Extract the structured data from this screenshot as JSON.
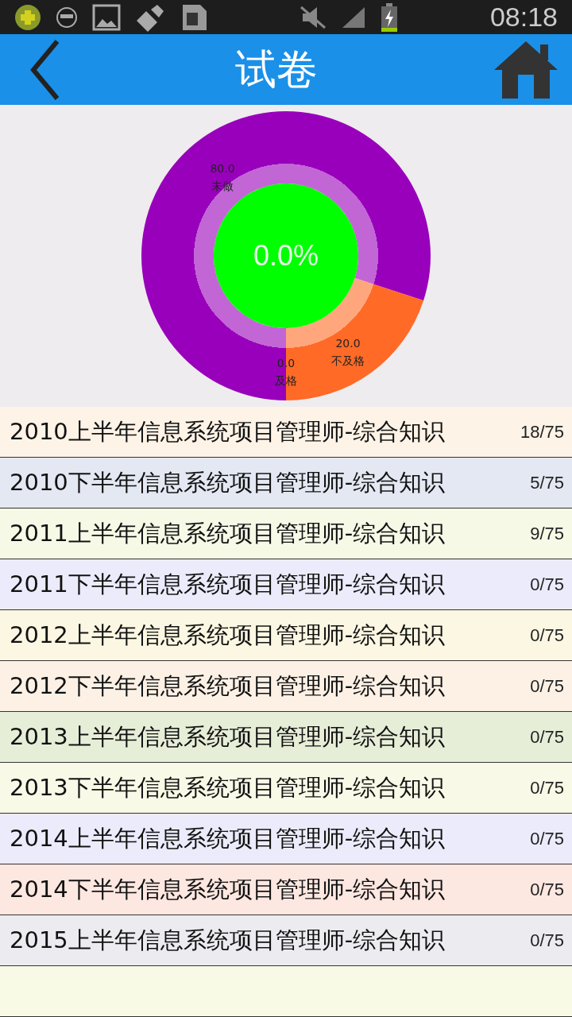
{
  "status_bar": {
    "time": "08:18"
  },
  "header": {
    "title": "试卷"
  },
  "chart": {
    "center_label": "0.0%",
    "chart_data": {
      "type": "donut",
      "categories": [
        "未做",
        "不及格",
        "及格"
      ],
      "values": [
        80.0,
        20.0,
        0.0
      ],
      "value_labels": [
        "80.0",
        "20.0",
        "0.0"
      ]
    },
    "segments": [
      {
        "color": "#9900bb"
      },
      {
        "color": "#ff6a26"
      }
    ]
  },
  "papers": [
    {
      "title": "2010上半年信息系统项目管理师-综合知识",
      "progress": "18/75",
      "color": "#fdf3e6"
    },
    {
      "title": "2010下半年信息系统项目管理师-综合知识",
      "progress": "5/75",
      "color": "#e3e8f2"
    },
    {
      "title": "2011上半年信息系统项目管理师-综合知识",
      "progress": "9/75",
      "color": "#f5f9e6"
    },
    {
      "title": "2011下半年信息系统项目管理师-综合知识",
      "progress": "0/75",
      "color": "#ecebfb"
    },
    {
      "title": "2012上半年信息系统项目管理师-综合知识",
      "progress": "0/75",
      "color": "#fbf7e2"
    },
    {
      "title": "2012下半年信息系统项目管理师-综合知识",
      "progress": "0/75",
      "color": "#fdf1e6"
    },
    {
      "title": "2013上半年信息系统项目管理师-综合知识",
      "progress": "0/75",
      "color": "#e7eed8"
    },
    {
      "title": "2013下半年信息系统项目管理师-综合知识",
      "progress": "0/75",
      "color": "#f8f9e6"
    },
    {
      "title": "2014上半年信息系统项目管理师-综合知识",
      "progress": "0/75",
      "color": "#ecebfb"
    },
    {
      "title": "2014下半年信息系统项目管理师-综合知识",
      "progress": "0/75",
      "color": "#fde7e1"
    },
    {
      "title": "2015上半年信息系统项目管理师-综合知识",
      "progress": "0/75",
      "color": "#ecebf0"
    },
    {
      "color": "#f8fae6"
    }
  ]
}
